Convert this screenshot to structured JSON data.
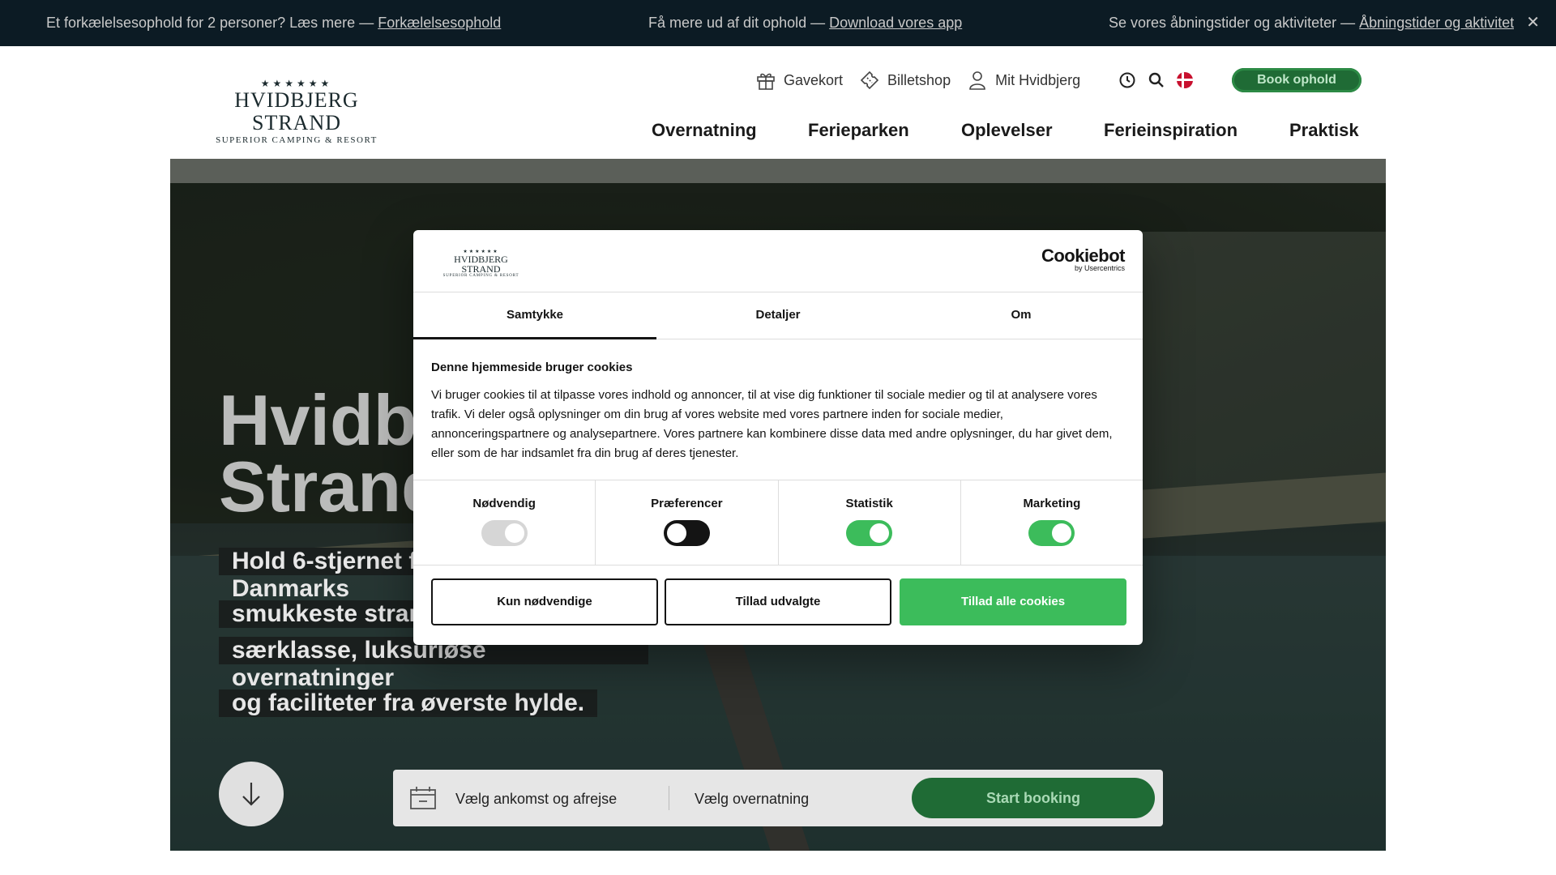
{
  "topbar": {
    "msg1_text": "Et forkælelsesophold for 2 personer? Læs mere — ",
    "msg1_link": "Forkælelsesophold",
    "msg2_text": "Få mere ud af dit ophold — ",
    "msg2_link": "Download vores app",
    "msg3_text": "Se vores åbningstider og aktiviteter — ",
    "msg3_link": "Åbningstider og aktiviteter",
    "close": "✕"
  },
  "logo": {
    "stars": "★★★★★★",
    "name": "HVIDBJERG STRAND",
    "sub": "SUPERIOR CAMPING & RESORT"
  },
  "utility": {
    "gift": "Gavekort",
    "tickets": "Billetshop",
    "account": "Mit Hvidbjerg",
    "book": "Book ophold"
  },
  "icons": {
    "gift": "gift-icon",
    "ticket": "ticket-icon",
    "user": "user-icon",
    "clock": "clock-icon",
    "search": "search-icon",
    "language": "danish-flag-icon",
    "arrow": "arrow-down-icon",
    "calendar": "calendar-icon"
  },
  "nav": [
    "Overnatning",
    "Ferieparken",
    "Oplevelser",
    "Ferieinspiration",
    "Praktisk"
  ],
  "hero": {
    "title_line1": "Hvidbjerg",
    "title_line2": "Strand",
    "sub_lines": [
      "Hold 6-stjernet ferie ved en af Danmarks",
      "smukkeste strande. Oplevelser i",
      "særklasse, luksuriøse overnatninger",
      "og faciliteter fra øverste hylde."
    ]
  },
  "booking": {
    "dates": "Vælg ankomst og afrejse",
    "stay": "Vælg overnatning",
    "start": "Start booking"
  },
  "cookie": {
    "logo_stars": "★★★★★★",
    "logo_name": "HVIDBJERG STRAND",
    "logo_sub": "SUPERIOR CAMPING & RESORT",
    "brand": "Cookiebot",
    "brand_by": "by Usercentrics",
    "tabs": [
      "Samtykke",
      "Detaljer",
      "Om"
    ],
    "heading": "Denne hjemmeside bruger cookies",
    "body": "Vi bruger cookies til at tilpasse vores indhold og annoncer, til at vise dig funktioner til sociale medier og til at analysere vores trafik. Vi deler også oplysninger om din brug af vores website med vores partnere inden for sociale medier, annonceringspartnere og analysepartnere. Vores partnere kan kombinere disse data med andre oplysninger, du har givet dem, eller som de har indsamlet fra din brug af deres tjenester.",
    "toggles": [
      {
        "label": "Nødvendig",
        "state": "disabled-on"
      },
      {
        "label": "Præferencer",
        "state": "off"
      },
      {
        "label": "Statistik",
        "state": "on"
      },
      {
        "label": "Marketing",
        "state": "on"
      }
    ],
    "btn_necessary": "Kun nødvendige",
    "btn_selected": "Tillad udvalgte",
    "btn_all": "Tillad alle cookies"
  },
  "colors": {
    "topbar_bg": "#0c1b24",
    "brand_green": "#1f6b35",
    "cookie_green": "#3cbc5b"
  }
}
